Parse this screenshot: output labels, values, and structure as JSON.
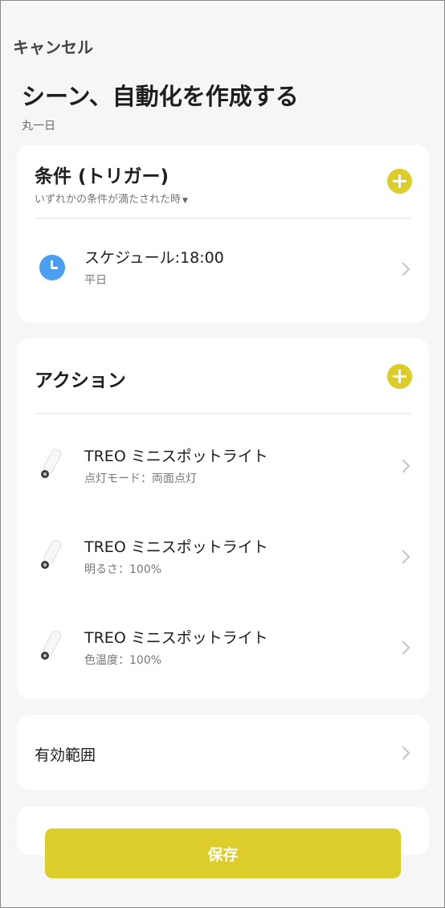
{
  "header": {
    "cancel_label": "キャンセル",
    "title": "シーン、自動化を作成する",
    "subtitle": "丸一日"
  },
  "trigger": {
    "title": "条件 (トリガー)",
    "mode": "いずれかの条件が満たされた時",
    "items": [
      {
        "icon": "clock-icon",
        "title": "スケジュール:18:00",
        "detail": "平日"
      }
    ]
  },
  "action": {
    "title": "アクション",
    "items": [
      {
        "icon": "spotlight-device-icon",
        "title": "TREO ミニスポットライト",
        "detail": "点灯モード：両面点灯"
      },
      {
        "icon": "spotlight-device-icon",
        "title": "TREO ミニスポットライト",
        "detail": "明るさ：100%"
      },
      {
        "icon": "spotlight-device-icon",
        "title": "TREO ミニスポットライト",
        "detail": "色温度：100%"
      }
    ]
  },
  "scope": {
    "label": "有効範囲"
  },
  "footer": {
    "save_label": "保存"
  },
  "colors": {
    "accent": "#dccd2a",
    "clock_icon": "#4a9ff2",
    "background": "#f6f6f6",
    "card": "#ffffff"
  }
}
